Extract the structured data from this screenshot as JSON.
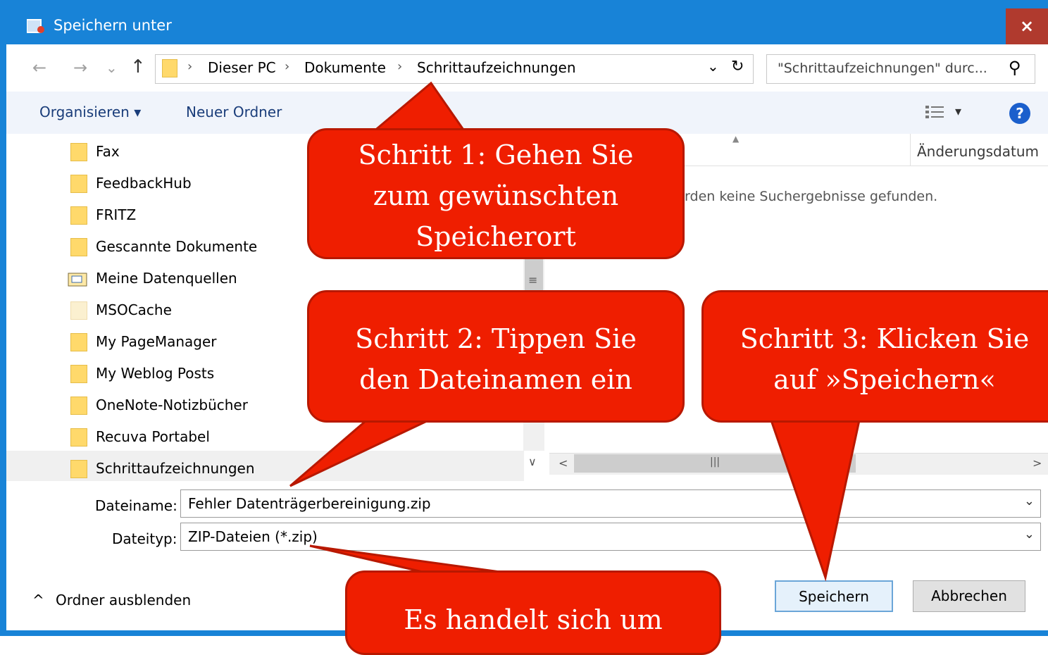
{
  "window": {
    "title": "Speichern unter",
    "close_label": "×"
  },
  "nav": {
    "back": "←",
    "forward": "→",
    "recent": "⌄",
    "up": "↑",
    "breadcrumb": [
      "Dieser PC",
      "Dokumente",
      "Schrittaufzeichnungen"
    ],
    "separator": "›",
    "dropdown": "⌄",
    "refresh": "↻",
    "search_placeholder": "\"Schrittaufzeichnungen\" durc...",
    "search_icon": "⚲"
  },
  "toolbar": {
    "organize": "Organisieren ▾",
    "new_folder": "Neuer Ordner",
    "view": "▾",
    "help": "?"
  },
  "tree": [
    {
      "label": "Fax",
      "icon": "folder-icon"
    },
    {
      "label": "FeedbackHub",
      "icon": "folder-icon"
    },
    {
      "label": "FRITZ",
      "icon": "folder-icon"
    },
    {
      "label": "Gescannte Dokumente",
      "icon": "folder-icon"
    },
    {
      "label": "Meine Datenquellen",
      "icon": "data-source-folder-icon"
    },
    {
      "label": "MSOCache",
      "icon": "hidden-folder-icon"
    },
    {
      "label": "My PageManager",
      "icon": "folder-icon"
    },
    {
      "label": "My Weblog Posts",
      "icon": "folder-icon"
    },
    {
      "label": "OneNote-Notizbücher",
      "icon": "folder-icon"
    },
    {
      "label": "Recuva Portabel",
      "icon": "folder-icon"
    },
    {
      "label": "Schrittaufzeichnungen",
      "icon": "folder-icon"
    }
  ],
  "list": {
    "column_date": "Änderungsdatum",
    "empty_message": "urden keine Suchergebnisse gefunden.",
    "scroll_mid": "|||",
    "scroll_left": "<",
    "scroll_right": ">",
    "scroll_down": "∨",
    "scroll_grip": "≡"
  },
  "form": {
    "filename_label": "Dateiname:",
    "filename_value": "Fehler Datenträgerbereinigung.zip",
    "filetype_label": "Dateityp:",
    "filetype_value": "ZIP-Dateien (*.zip)",
    "chevron": "⌄"
  },
  "footer": {
    "hide_folders": "Ordner ausblenden",
    "hide_icon": "^",
    "save": "Speichern",
    "cancel": "Abbrechen"
  },
  "callouts": {
    "step1": [
      "Schritt 1: Gehen Sie",
      "zum gewünschten",
      "Speicherort"
    ],
    "step2": [
      "Schritt 2: Tippen Sie",
      "den Dateinamen ein"
    ],
    "step3": [
      "Schritt 3: Klicken Sie",
      "auf »Speichern«"
    ],
    "note": [
      "Es handelt sich um"
    ]
  },
  "colors": {
    "title_bar": "#1883d7",
    "callout_fill": "#ef1e00",
    "callout_border": "#b81800"
  }
}
